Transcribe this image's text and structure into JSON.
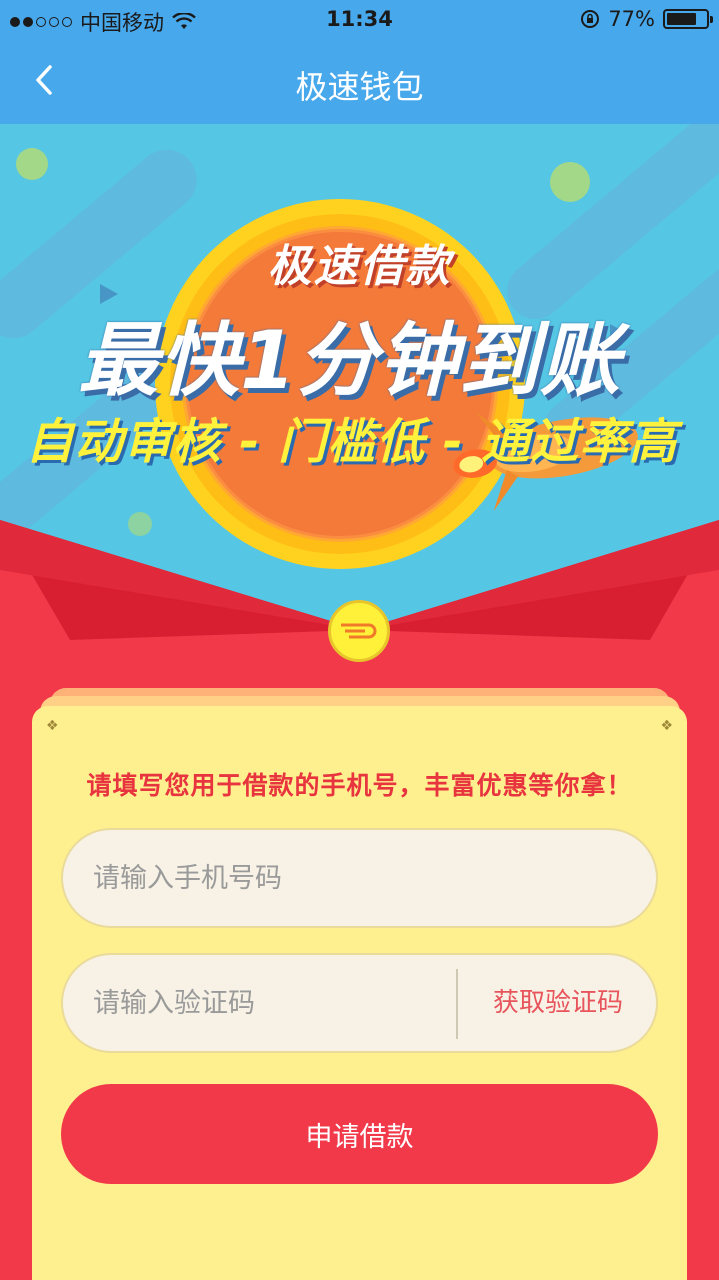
{
  "status_bar": {
    "carrier": "中国移动",
    "time": "11:34",
    "battery": "77%",
    "battery_level": 0.77,
    "signal_bars_filled": 2,
    "signal_bars_total": 5
  },
  "nav": {
    "title": "极速钱包",
    "back_icon": "chevron-left-icon"
  },
  "banner": {
    "line1": "极速借款",
    "line2": "最快1分钟到账",
    "line3": "自动审核 - 门槛低 - 通过率高"
  },
  "form": {
    "title": "请填写您用于借款的手机号，丰富优惠等你拿！",
    "phone_placeholder": "请输入手机号码",
    "code_placeholder": "请输入验证码",
    "get_code_label": "获取验证码",
    "submit_label": "申请借款"
  },
  "colors": {
    "nav_blue": "#48a8ec",
    "banner_blue": "#55c6e3",
    "envelope_red": "#f2394a",
    "card_yellow": "#fff08f",
    "accent_red_text": "#e8343f"
  }
}
